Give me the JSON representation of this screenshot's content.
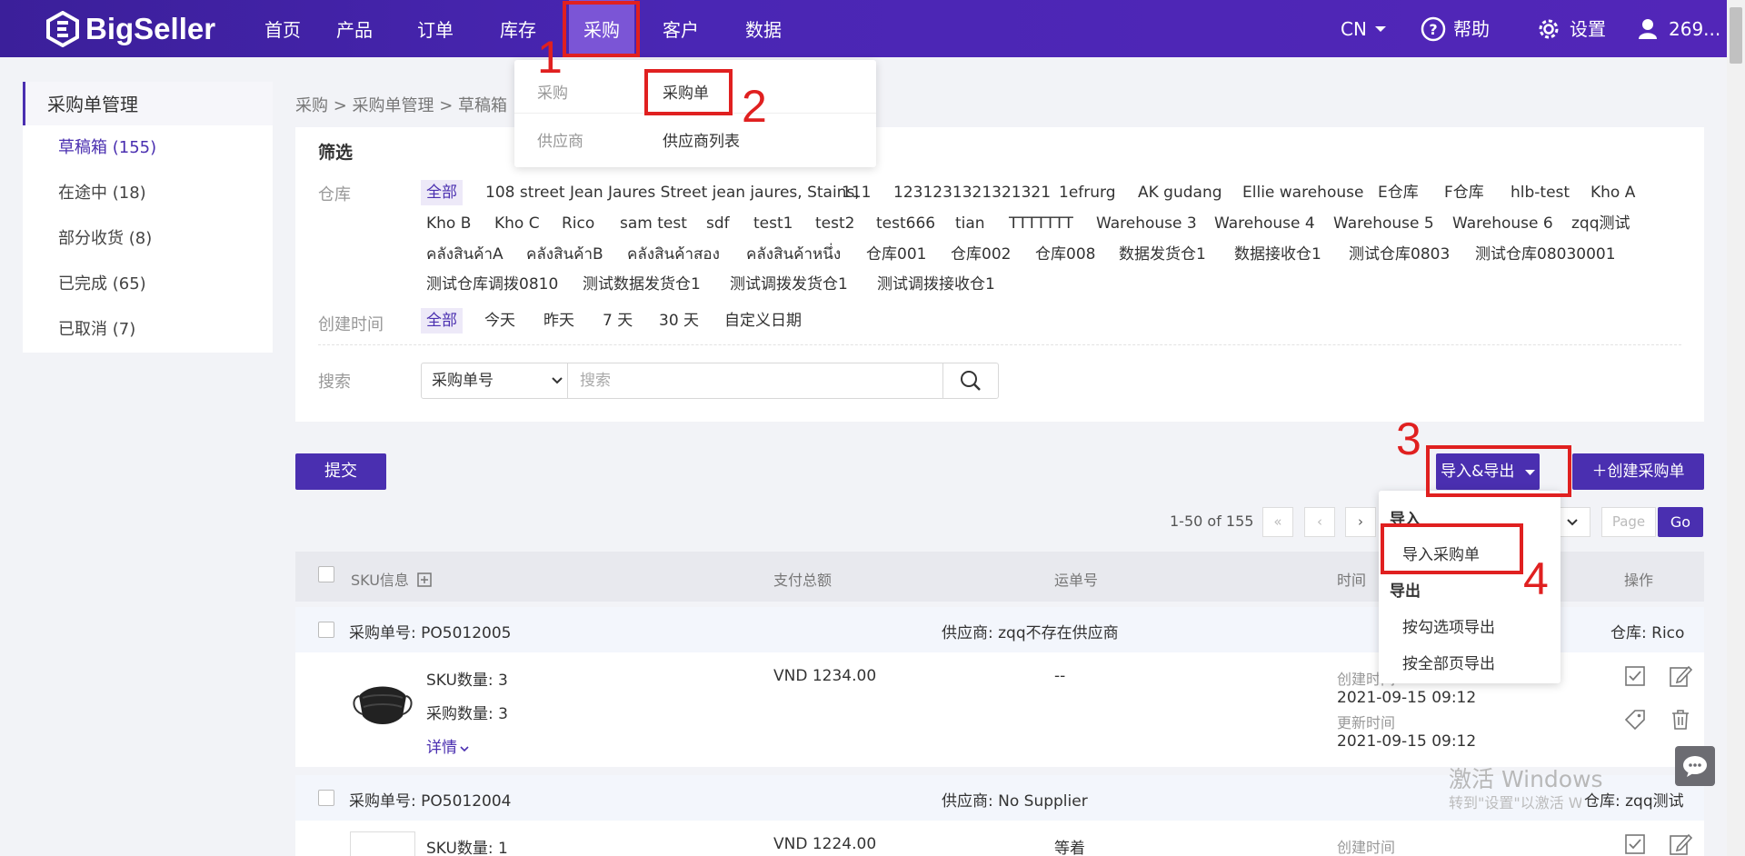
{
  "header": {
    "brand": "BigSeller",
    "nav": [
      "首页",
      "产品",
      "订单",
      "库存",
      "采购",
      "客户",
      "数据"
    ],
    "active_nav": "采购",
    "lang": "CN",
    "help": "帮助",
    "settings": "设置",
    "user": "269..."
  },
  "annotations": [
    "1",
    "2",
    "3",
    "4"
  ],
  "purchase_menu": {
    "rows": [
      {
        "group": "采购",
        "item": "采购单"
      },
      {
        "group": "供应商",
        "item": "供应商列表"
      }
    ]
  },
  "sidebar": {
    "title": "采购单管理",
    "items": [
      "草稿箱 (155)",
      "在途中 (18)",
      "部分收货 (8)",
      "已完成 (65)",
      "已取消 (7)"
    ]
  },
  "breadcrumb": "采购 > 采购单管理 > 草稿箱",
  "filter": {
    "title": "筛选",
    "warehouse_label": "仓库",
    "warehouses_row1": [
      "全部",
      "108 street Jean Jaures Street jean jaures, Stains,",
      "111",
      "1231231321321321",
      "1efrurg",
      "AK gudang",
      "Ellie warehouse",
      "E仓库",
      "F仓库",
      "hlb-test",
      "Kho A"
    ],
    "warehouses_row2": [
      "Kho B",
      "Kho C",
      "Rico",
      "sam test",
      "sdf",
      "test1",
      "test2",
      "test666",
      "tian",
      "TTTTTTT",
      "Warehouse 3",
      "Warehouse 4",
      "Warehouse 5",
      "Warehouse 6",
      "zqq测试"
    ],
    "warehouses_row3": [
      "คลังสินค้าA",
      "คลังสินค้าB",
      "คลังสินค้าสอง",
      "คลังสินค้าหนึ่ง",
      "仓库001",
      "仓库002",
      "仓库008",
      "数据发货仓1",
      "数据接收仓1",
      "测试仓库0803",
      "测试仓库08030001"
    ],
    "warehouses_row4": [
      "测试仓库调拨0810",
      "测试数据发货仓1",
      "测试调拨发货仓1",
      "测试调拨接收仓1"
    ],
    "time_label": "创建时间",
    "time_options": [
      "全部",
      "今天",
      "昨天",
      "7 天",
      "30 天",
      "自定义日期"
    ],
    "search_label": "搜索",
    "search_type": "采购单号",
    "search_placeholder": "搜索"
  },
  "actions": {
    "submit": "提交",
    "import_export": "导入&导出",
    "create": "创建采购单"
  },
  "pagination": {
    "range": "1-50 of 155",
    "page_placeholder": "Page",
    "go": "Go"
  },
  "import_export_menu": {
    "import_header": "导入",
    "import_items": [
      "导入采购单"
    ],
    "export_header": "导出",
    "export_items": [
      "按勾选项导出",
      "按全部页导出"
    ]
  },
  "table": {
    "columns": [
      "SKU信息",
      "支付总额",
      "运单号",
      "时间",
      "操作"
    ],
    "rows": [
      {
        "po": "采购单号: PO5012005",
        "supplier": "供应商: zqq不存在供应商",
        "warehouse": "仓库: Rico",
        "sku_count": "SKU数量: 3",
        "qty": "采购数量: 3",
        "detail": "详情",
        "total": "VND 1234.00",
        "tracking": "--",
        "created_label": "创建时间",
        "created": "2021-09-15 09:12",
        "updated_label": "更新时间",
        "updated": "2021-09-15 09:12"
      },
      {
        "po": "采购单号: PO5012004",
        "supplier": "供应商: No Supplier",
        "warehouse": "仓库: zqq测试",
        "sku_count": "SKU数量: 1",
        "total": "VND 1224.00",
        "tracking": "等着",
        "created_label": "创建时间"
      }
    ]
  },
  "watermark": {
    "line1": "激活 Windows",
    "line2": "转到\"设置\"以激活 Windows。"
  }
}
